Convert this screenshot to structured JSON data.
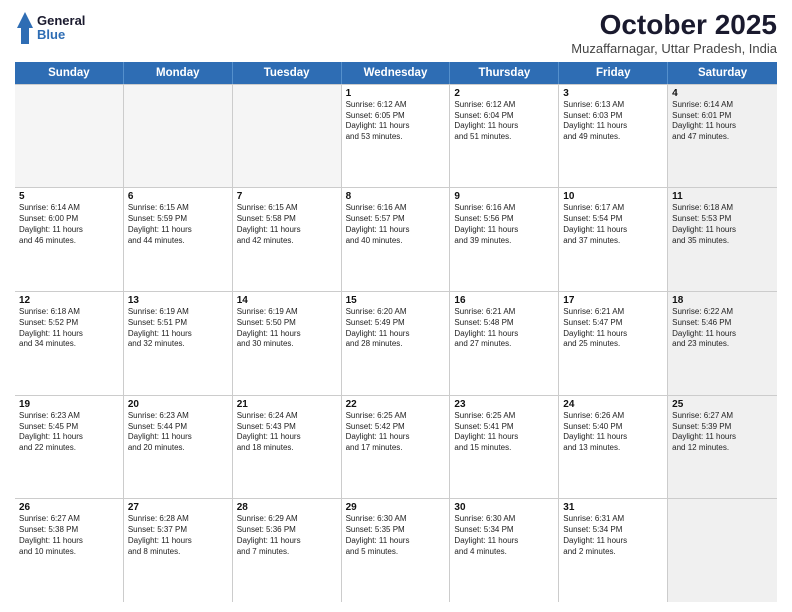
{
  "header": {
    "logo_line1": "General",
    "logo_line2": "Blue",
    "title": "October 2025",
    "subtitle": "Muzaffarnagar, Uttar Pradesh, India"
  },
  "weekdays": [
    "Sunday",
    "Monday",
    "Tuesday",
    "Wednesday",
    "Thursday",
    "Friday",
    "Saturday"
  ],
  "rows": [
    [
      {
        "day": "",
        "info": "",
        "empty": true
      },
      {
        "day": "",
        "info": "",
        "empty": true
      },
      {
        "day": "",
        "info": "",
        "empty": true
      },
      {
        "day": "1",
        "info": "Sunrise: 6:12 AM\nSunset: 6:05 PM\nDaylight: 11 hours and 53 minutes."
      },
      {
        "day": "2",
        "info": "Sunrise: 6:12 AM\nSunset: 6:04 PM\nDaylight: 11 hours and 51 minutes."
      },
      {
        "day": "3",
        "info": "Sunrise: 6:13 AM\nSunset: 6:03 PM\nDaylight: 11 hours and 49 minutes."
      },
      {
        "day": "4",
        "info": "Sunrise: 6:14 AM\nSunset: 6:01 PM\nDaylight: 11 hours and 47 minutes.",
        "shaded": true
      }
    ],
    [
      {
        "day": "5",
        "info": "Sunrise: 6:14 AM\nSunset: 6:00 PM\nDaylight: 11 hours and 46 minutes."
      },
      {
        "day": "6",
        "info": "Sunrise: 6:15 AM\nSunset: 5:59 PM\nDaylight: 11 hours and 44 minutes."
      },
      {
        "day": "7",
        "info": "Sunrise: 6:15 AM\nSunset: 5:58 PM\nDaylight: 11 hours and 42 minutes."
      },
      {
        "day": "8",
        "info": "Sunrise: 6:16 AM\nSunset: 5:57 PM\nDaylight: 11 hours and 40 minutes."
      },
      {
        "day": "9",
        "info": "Sunrise: 6:16 AM\nSunset: 5:56 PM\nDaylight: 11 hours and 39 minutes."
      },
      {
        "day": "10",
        "info": "Sunrise: 6:17 AM\nSunset: 5:54 PM\nDaylight: 11 hours and 37 minutes."
      },
      {
        "day": "11",
        "info": "Sunrise: 6:18 AM\nSunset: 5:53 PM\nDaylight: 11 hours and 35 minutes.",
        "shaded": true
      }
    ],
    [
      {
        "day": "12",
        "info": "Sunrise: 6:18 AM\nSunset: 5:52 PM\nDaylight: 11 hours and 34 minutes."
      },
      {
        "day": "13",
        "info": "Sunrise: 6:19 AM\nSunset: 5:51 PM\nDaylight: 11 hours and 32 minutes."
      },
      {
        "day": "14",
        "info": "Sunrise: 6:19 AM\nSunset: 5:50 PM\nDaylight: 11 hours and 30 minutes."
      },
      {
        "day": "15",
        "info": "Sunrise: 6:20 AM\nSunset: 5:49 PM\nDaylight: 11 hours and 28 minutes."
      },
      {
        "day": "16",
        "info": "Sunrise: 6:21 AM\nSunset: 5:48 PM\nDaylight: 11 hours and 27 minutes."
      },
      {
        "day": "17",
        "info": "Sunrise: 6:21 AM\nSunset: 5:47 PM\nDaylight: 11 hours and 25 minutes."
      },
      {
        "day": "18",
        "info": "Sunrise: 6:22 AM\nSunset: 5:46 PM\nDaylight: 11 hours and 23 minutes.",
        "shaded": true
      }
    ],
    [
      {
        "day": "19",
        "info": "Sunrise: 6:23 AM\nSunset: 5:45 PM\nDaylight: 11 hours and 22 minutes."
      },
      {
        "day": "20",
        "info": "Sunrise: 6:23 AM\nSunset: 5:44 PM\nDaylight: 11 hours and 20 minutes."
      },
      {
        "day": "21",
        "info": "Sunrise: 6:24 AM\nSunset: 5:43 PM\nDaylight: 11 hours and 18 minutes."
      },
      {
        "day": "22",
        "info": "Sunrise: 6:25 AM\nSunset: 5:42 PM\nDaylight: 11 hours and 17 minutes."
      },
      {
        "day": "23",
        "info": "Sunrise: 6:25 AM\nSunset: 5:41 PM\nDaylight: 11 hours and 15 minutes."
      },
      {
        "day": "24",
        "info": "Sunrise: 6:26 AM\nSunset: 5:40 PM\nDaylight: 11 hours and 13 minutes."
      },
      {
        "day": "25",
        "info": "Sunrise: 6:27 AM\nSunset: 5:39 PM\nDaylight: 11 hours and 12 minutes.",
        "shaded": true
      }
    ],
    [
      {
        "day": "26",
        "info": "Sunrise: 6:27 AM\nSunset: 5:38 PM\nDaylight: 11 hours and 10 minutes."
      },
      {
        "day": "27",
        "info": "Sunrise: 6:28 AM\nSunset: 5:37 PM\nDaylight: 11 hours and 8 minutes."
      },
      {
        "day": "28",
        "info": "Sunrise: 6:29 AM\nSunset: 5:36 PM\nDaylight: 11 hours and 7 minutes."
      },
      {
        "day": "29",
        "info": "Sunrise: 6:30 AM\nSunset: 5:35 PM\nDaylight: 11 hours and 5 minutes."
      },
      {
        "day": "30",
        "info": "Sunrise: 6:30 AM\nSunset: 5:34 PM\nDaylight: 11 hours and 4 minutes."
      },
      {
        "day": "31",
        "info": "Sunrise: 6:31 AM\nSunset: 5:34 PM\nDaylight: 11 hours and 2 minutes."
      },
      {
        "day": "",
        "info": "",
        "empty": true,
        "shaded": true
      }
    ]
  ]
}
